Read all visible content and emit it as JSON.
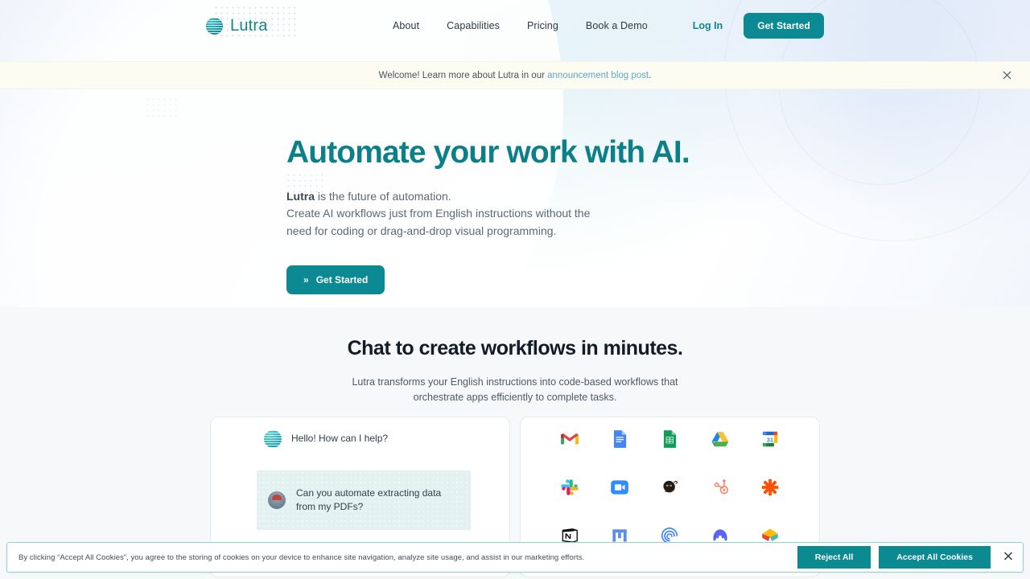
{
  "brand": {
    "name": "Lutra",
    "logo_icon": "lutra-sphere-icon",
    "accent_color": "#0c8a93"
  },
  "nav": {
    "links": [
      {
        "label": "About"
      },
      {
        "label": "Capabilities"
      },
      {
        "label": "Pricing"
      },
      {
        "label": "Book a Demo"
      }
    ],
    "login_label": "Log In",
    "cta_label": "Get Started"
  },
  "announcement": {
    "prefix": "Welcome! Learn more about Lutra in our ",
    "link_label": "announcement blog post",
    "suffix": ".",
    "close_icon": "close-icon"
  },
  "hero": {
    "title": "Automate your work with AI.",
    "sub_bold": "Lutra",
    "sub_rest": " is the future of automation.",
    "sub_line2": "Create AI workflows just from English instructions without the",
    "sub_line3": "need for coding or drag-and-drop visual programming.",
    "cta_label": "Get Started",
    "cta_icon": "double-chevron-right-icon"
  },
  "section2": {
    "title": "Chat to create workflows in minutes.",
    "sub_line1": "Lutra transforms your English instructions into code-based workflows that",
    "sub_line2": "orchestrate apps efficiently to complete tasks.",
    "chat": {
      "bot_avatar_icon": "lutra-bot-avatar-icon",
      "bot_message": "Hello! How can I help?",
      "user_avatar_icon": "user-avatar-icon",
      "user_message": "Can you automate extracting data from my PDFs?"
    },
    "apps": [
      {
        "name": "gmail-icon",
        "label": "Gmail"
      },
      {
        "name": "google-docs-icon",
        "label": "Google Docs"
      },
      {
        "name": "google-sheets-icon",
        "label": "Google Sheets"
      },
      {
        "name": "google-drive-icon",
        "label": "Google Drive"
      },
      {
        "name": "google-calendar-icon",
        "label": "Google Calendar"
      },
      {
        "name": "slack-icon",
        "label": "Slack"
      },
      {
        "name": "zoom-icon",
        "label": "Zoom"
      },
      {
        "name": "mailchimp-icon",
        "label": "Mailchimp"
      },
      {
        "name": "hubspot-icon",
        "label": "HubSpot"
      },
      {
        "name": "zapier-icon",
        "label": "Zapier"
      },
      {
        "name": "notion-icon",
        "label": "Notion"
      },
      {
        "name": "monday-icon",
        "label": "Monday.com"
      },
      {
        "name": "wave-icon",
        "label": "Wave"
      },
      {
        "name": "discord-icon",
        "label": "Discord"
      },
      {
        "name": "stack-icon",
        "label": "Stack"
      }
    ]
  },
  "cookie": {
    "text": "By clicking “Accept All Cookies”, you agree to the storing of cookies on your device to enhance site navigation, analyze site usage, and assist in our marketing efforts.",
    "reject_label": "Reject All",
    "accept_label": "Accept All Cookies",
    "close_icon": "close-icon"
  }
}
